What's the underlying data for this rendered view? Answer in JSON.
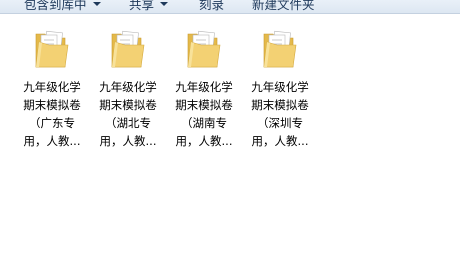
{
  "toolbar": {
    "include_in_library": "包含到库中",
    "share": "共享",
    "burn": "刻录",
    "new_folder": "新建文件夹"
  },
  "files": [
    {
      "label": "九年级化学\n期末模拟卷\n（广东专\n用，人教..."
    },
    {
      "label": "九年级化学\n期末模拟卷\n（湖北专\n用，人教..."
    },
    {
      "label": "九年级化学\n期末模拟卷\n（湖南专\n用，人教..."
    },
    {
      "label": "九年级化学\n期末模拟卷\n（深圳专\n用，人教..."
    }
  ],
  "colors": {
    "toolbar_bg": "#dde7f2",
    "toolbar_text": "#1e395b",
    "folder_body": "#f3d173",
    "folder_back": "#e4b94a"
  }
}
